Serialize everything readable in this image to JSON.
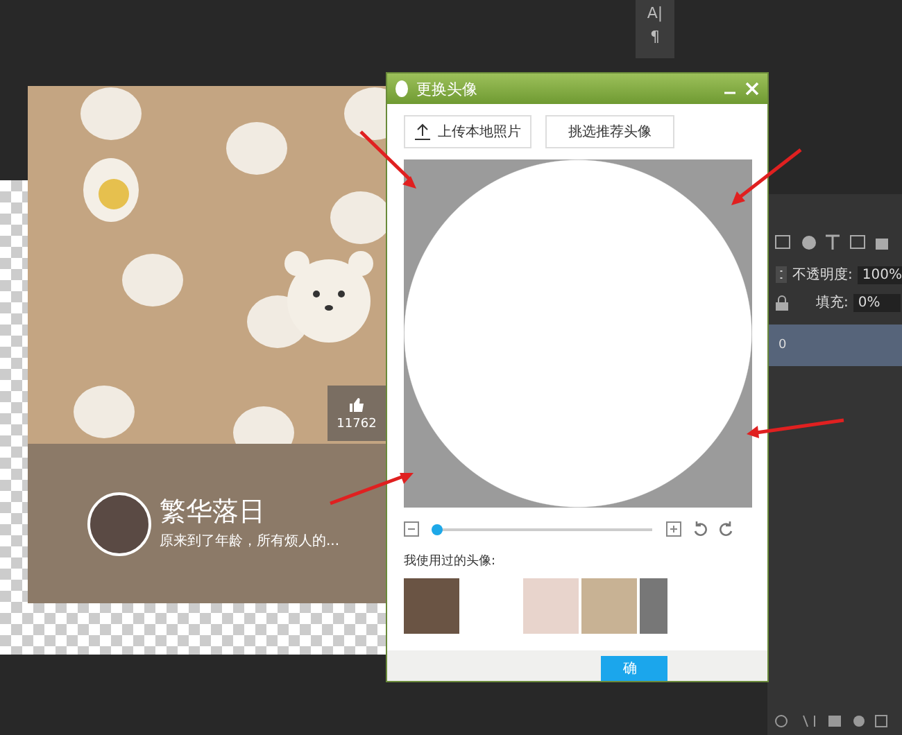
{
  "toolbox": {
    "items": [
      "A|",
      "¶"
    ]
  },
  "card": {
    "like_count": "11762",
    "name": "繁华落日",
    "bio": "原来到了年龄，所有烦人的..."
  },
  "dialog": {
    "title": "更换头像",
    "buttons": [
      "上传本地照片",
      "挑选推荐头像"
    ],
    "zoom": {
      "level": 0
    },
    "history_label": "我使用过的头像:",
    "confirm": "确"
  },
  "layers_panel": {
    "opacity_label": "不透明度:",
    "opacity": "100%",
    "fill_label": "填充:",
    "fill": "0%",
    "layers": [
      {
        "name": "0",
        "selected": true
      }
    ]
  }
}
